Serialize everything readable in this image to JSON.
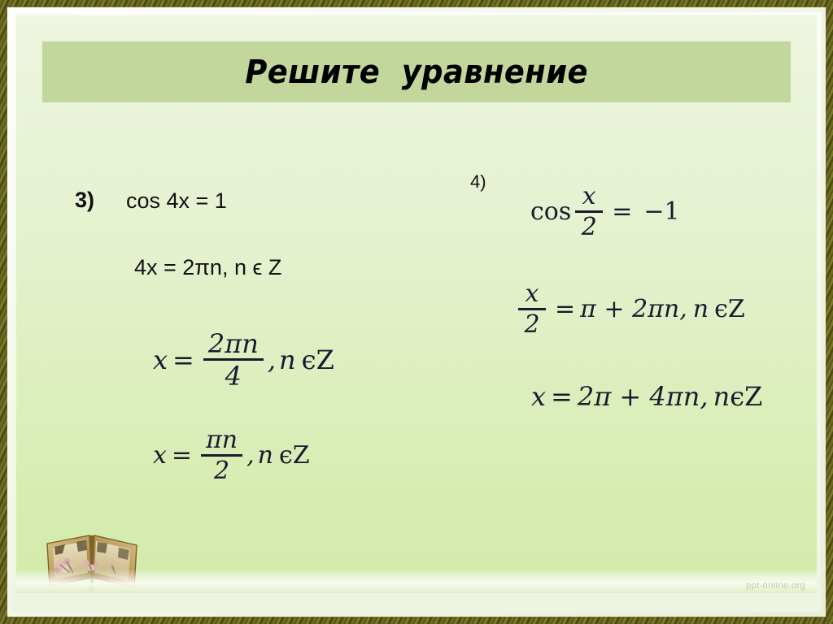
{
  "slide": {
    "title": "Решите  уравнение",
    "background_top_color": "#eef5e0",
    "background_bottom_color": "#d4eaab",
    "title_band_color": "#c3d69b",
    "frame_color": "#6d6b22",
    "watermark": "ppt-online.org"
  },
  "problems": [
    {
      "number": "3)",
      "equation": "cos 4x = 1",
      "steps": [
        {
          "kind": "sans",
          "text": "4x = 2πn, n ϵ Z"
        }
      ],
      "math_steps": [
        {
          "id": "left-step-1",
          "lhs_var": "x",
          "relation": "=",
          "fraction": {
            "numerator": "2πn",
            "denominator": "4"
          },
          "suffix_comma": ",",
          "suffix_var": "n",
          "suffix_member": "ϵZ"
        },
        {
          "id": "left-step-2",
          "lhs_var": "x",
          "relation": "=",
          "fraction": {
            "numerator": "πn",
            "denominator": "2"
          },
          "suffix_comma": ",",
          "suffix_var": "n",
          "suffix_member": "ϵZ"
        }
      ]
    },
    {
      "number": "4)",
      "equation_math": {
        "id": "right-equation",
        "func": "cos",
        "fraction": {
          "numerator": "x",
          "denominator": "2"
        },
        "relation": "=",
        "rhs": "−1"
      },
      "math_steps": [
        {
          "id": "right-step-1",
          "fraction": {
            "numerator": "x",
            "denominator": "2"
          },
          "relation": "=",
          "rhs": "π + 2πn",
          "suffix_comma": ",",
          "suffix_var": "n",
          "suffix_member": "ϵZ"
        },
        {
          "id": "right-step-2",
          "lhs_var": "x",
          "relation": "=",
          "rhs": "2π + 4πn",
          "suffix_comma": ",",
          "suffix_var": "n",
          "suffix_member": "ϵZ"
        }
      ]
    }
  ],
  "decoration": {
    "book_icon": "open-book-illustration"
  }
}
